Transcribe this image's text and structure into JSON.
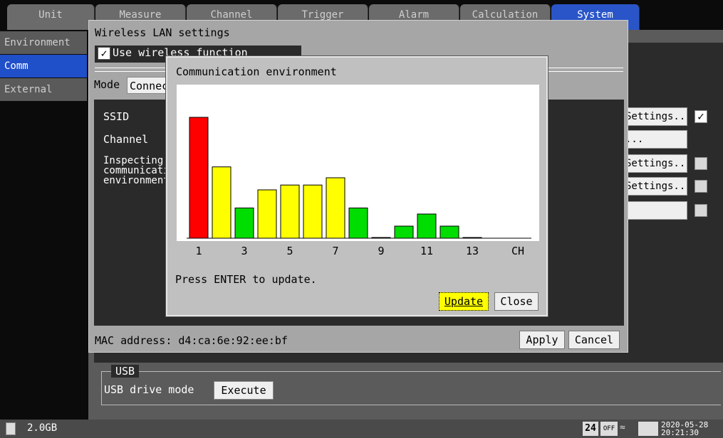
{
  "tabs": [
    "Unit",
    "Measure",
    "Channel",
    "Trigger",
    "Alarm",
    "Calculation",
    "System"
  ],
  "sidebar": [
    "Environment",
    "Comm",
    "External"
  ],
  "right_buttons": [
    {
      "label": "Settings...",
      "checked": true
    },
    {
      "label": "...",
      "checked": null
    },
    {
      "label": "Settings...",
      "checked": false
    },
    {
      "label": "Settings...",
      "checked": false
    },
    {
      "label": "",
      "checked": false
    }
  ],
  "wlan": {
    "title": "Wireless LAN settings",
    "use_label": "Use wireless function",
    "mode_label": "Mode",
    "mode_value": "Connect",
    "ssid_label": "SSID",
    "channel_label": "Channel",
    "inspect_label": [
      "Inspecting",
      "communication",
      "environment"
    ],
    "mac_label": "MAC address:",
    "mac_value": "d4:ca:6e:92:ee:bf",
    "apply": "Apply",
    "cancel": "Cancel"
  },
  "comm_dialog": {
    "title": "Communication environment",
    "hint": "Press ENTER to update.",
    "update": "Update",
    "close": "Close"
  },
  "chart_data": {
    "type": "bar",
    "categories": [
      "1",
      "2",
      "3",
      "4",
      "5",
      "6",
      "7",
      "8",
      "9",
      "10",
      "11",
      "12",
      "13"
    ],
    "values": [
      100,
      59,
      25,
      40,
      44,
      44,
      50,
      25,
      0.5,
      10,
      20,
      10,
      0.5
    ],
    "colors": [
      "#ff0000",
      "#ffff00",
      "#00dd00",
      "#ffff00",
      "#ffff00",
      "#ffff00",
      "#ffff00",
      "#00dd00",
      "#00dd00",
      "#00dd00",
      "#00dd00",
      "#00dd00",
      "#00dd00"
    ],
    "tick_labels": [
      "1",
      "3",
      "5",
      "7",
      "9",
      "11",
      "13",
      "CH"
    ],
    "ylim": [
      0,
      100
    ]
  },
  "usb": {
    "legend": "USB",
    "label": "USB drive mode",
    "button": "Execute"
  },
  "status": {
    "storage": "2.0GB",
    "date": "2020-05-28",
    "time": "20:21:30"
  }
}
